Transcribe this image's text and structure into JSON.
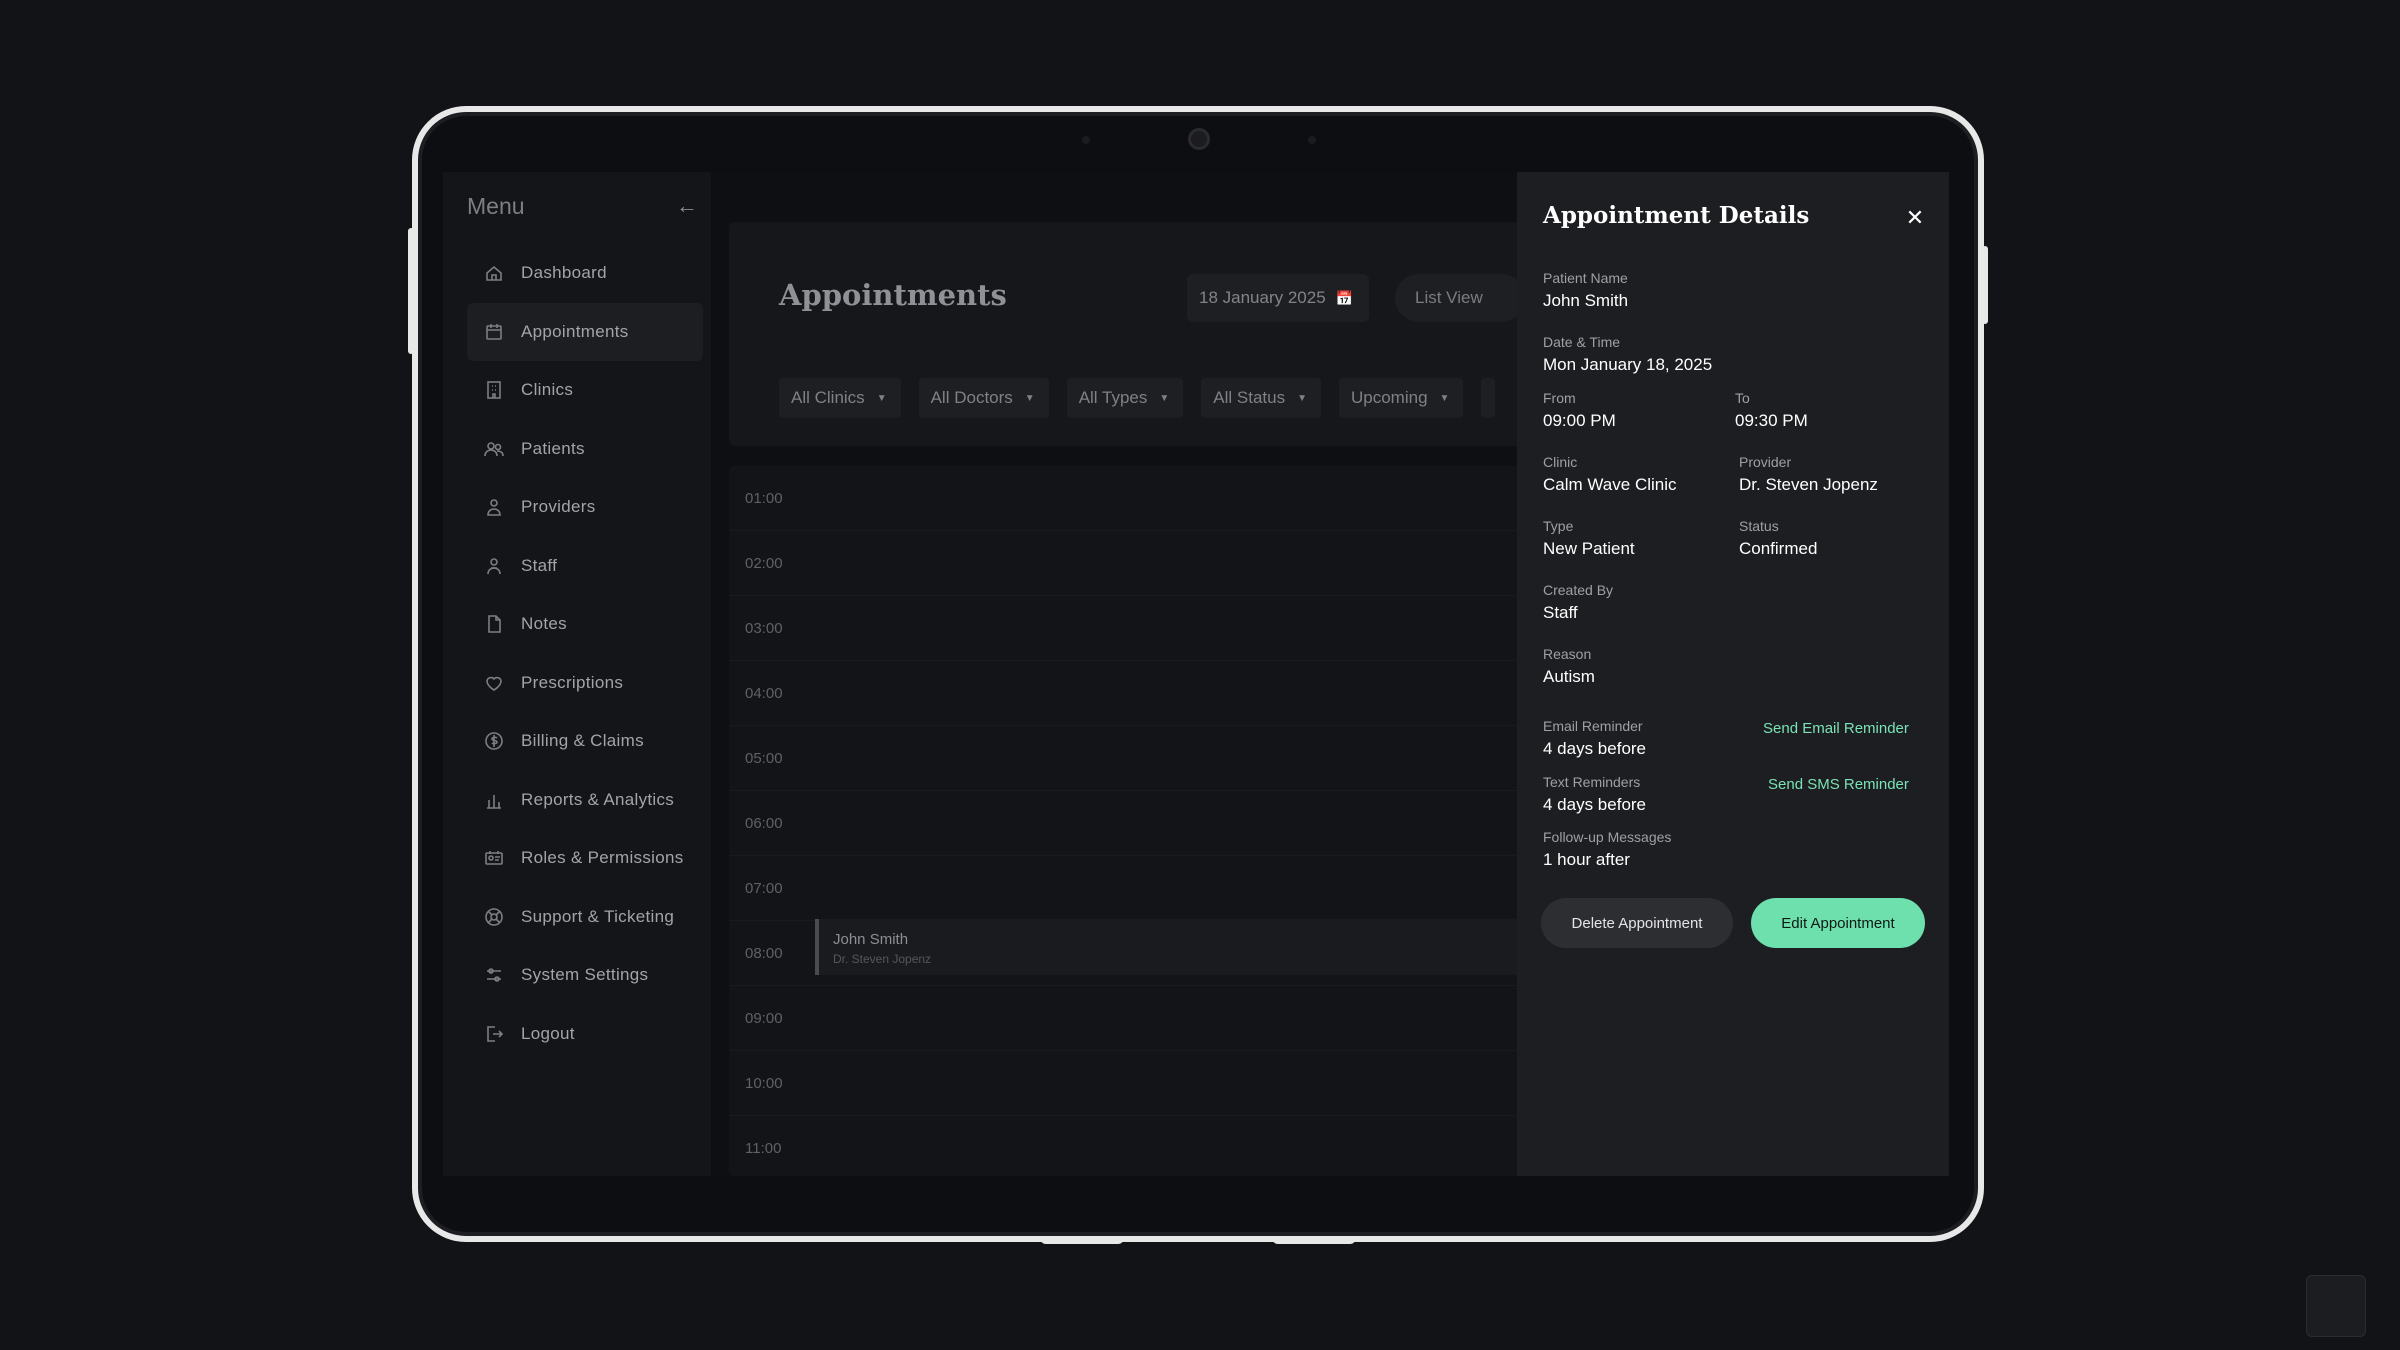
{
  "sidebar": {
    "title": "Menu",
    "items": [
      {
        "label": "Dashboard",
        "icon": "home-icon"
      },
      {
        "label": "Appointments",
        "icon": "calendar-icon"
      },
      {
        "label": "Clinics",
        "icon": "building-icon"
      },
      {
        "label": "Patients",
        "icon": "users-icon"
      },
      {
        "label": "Providers",
        "icon": "user-group-icon"
      },
      {
        "label": "Staff",
        "icon": "staff-icon"
      },
      {
        "label": "Notes",
        "icon": "document-icon"
      },
      {
        "label": "Prescriptions",
        "icon": "heart-icon"
      },
      {
        "label": "Billing & Claims",
        "icon": "dollar-icon"
      },
      {
        "label": "Reports & Analytics",
        "icon": "bar-chart-icon"
      },
      {
        "label": "Roles & Permissions",
        "icon": "id-card-icon"
      },
      {
        "label": "Support & Ticketing",
        "icon": "lifebuoy-icon"
      },
      {
        "label": "System Settings",
        "icon": "sliders-icon"
      },
      {
        "label": "Logout",
        "icon": "logout-icon"
      }
    ],
    "active_index": 1
  },
  "main": {
    "title": "Appointments",
    "date": "18 January 2025",
    "view": "List View",
    "filters": [
      "All Clinics",
      "All Doctors",
      "All Types",
      "All Status",
      "Upcoming"
    ]
  },
  "schedule": {
    "times": [
      "01:00",
      "02:00",
      "03:00",
      "04:00",
      "05:00",
      "06:00",
      "07:00",
      "08:00",
      "09:00",
      "10:00",
      "11:00"
    ],
    "event": {
      "name": "John Smith",
      "provider": "Dr. Steven Jopenz"
    }
  },
  "details": {
    "title": "Appointment Details",
    "patient_name_label": "Patient Name",
    "patient_name": "John Smith",
    "datetime_label": "Date & Time",
    "datetime": "Mon January 18, 2025",
    "from_label": "From",
    "from": "09:00 PM",
    "to_label": "To",
    "to": "09:30 PM",
    "clinic_label": "Clinic",
    "clinic": "Calm Wave Clinic",
    "provider_label": "Provider",
    "provider": "Dr. Steven Jopenz",
    "type_label": "Type",
    "type": "New Patient",
    "status_label": "Status",
    "status": "Confirmed",
    "created_by_label": "Created By",
    "created_by": "Staff",
    "reason_label": "Reason",
    "reason": "Autism",
    "email_reminder_label": "Email Reminder",
    "email_reminder": "4 days before",
    "send_email_label": "Send Email Reminder",
    "text_reminders_label": "Text Reminders",
    "text_reminders": "4 days before",
    "send_sms_label": "Send SMS Reminder",
    "followup_label": "Follow-up Messages",
    "followup": "1 hour after",
    "delete_label": "Delete Appointment",
    "edit_label": "Edit Appointment"
  },
  "colors": {
    "accent": "#6ee0ae",
    "link": "#7be3b6",
    "background": "#121317",
    "panel": "#1d1e21"
  }
}
